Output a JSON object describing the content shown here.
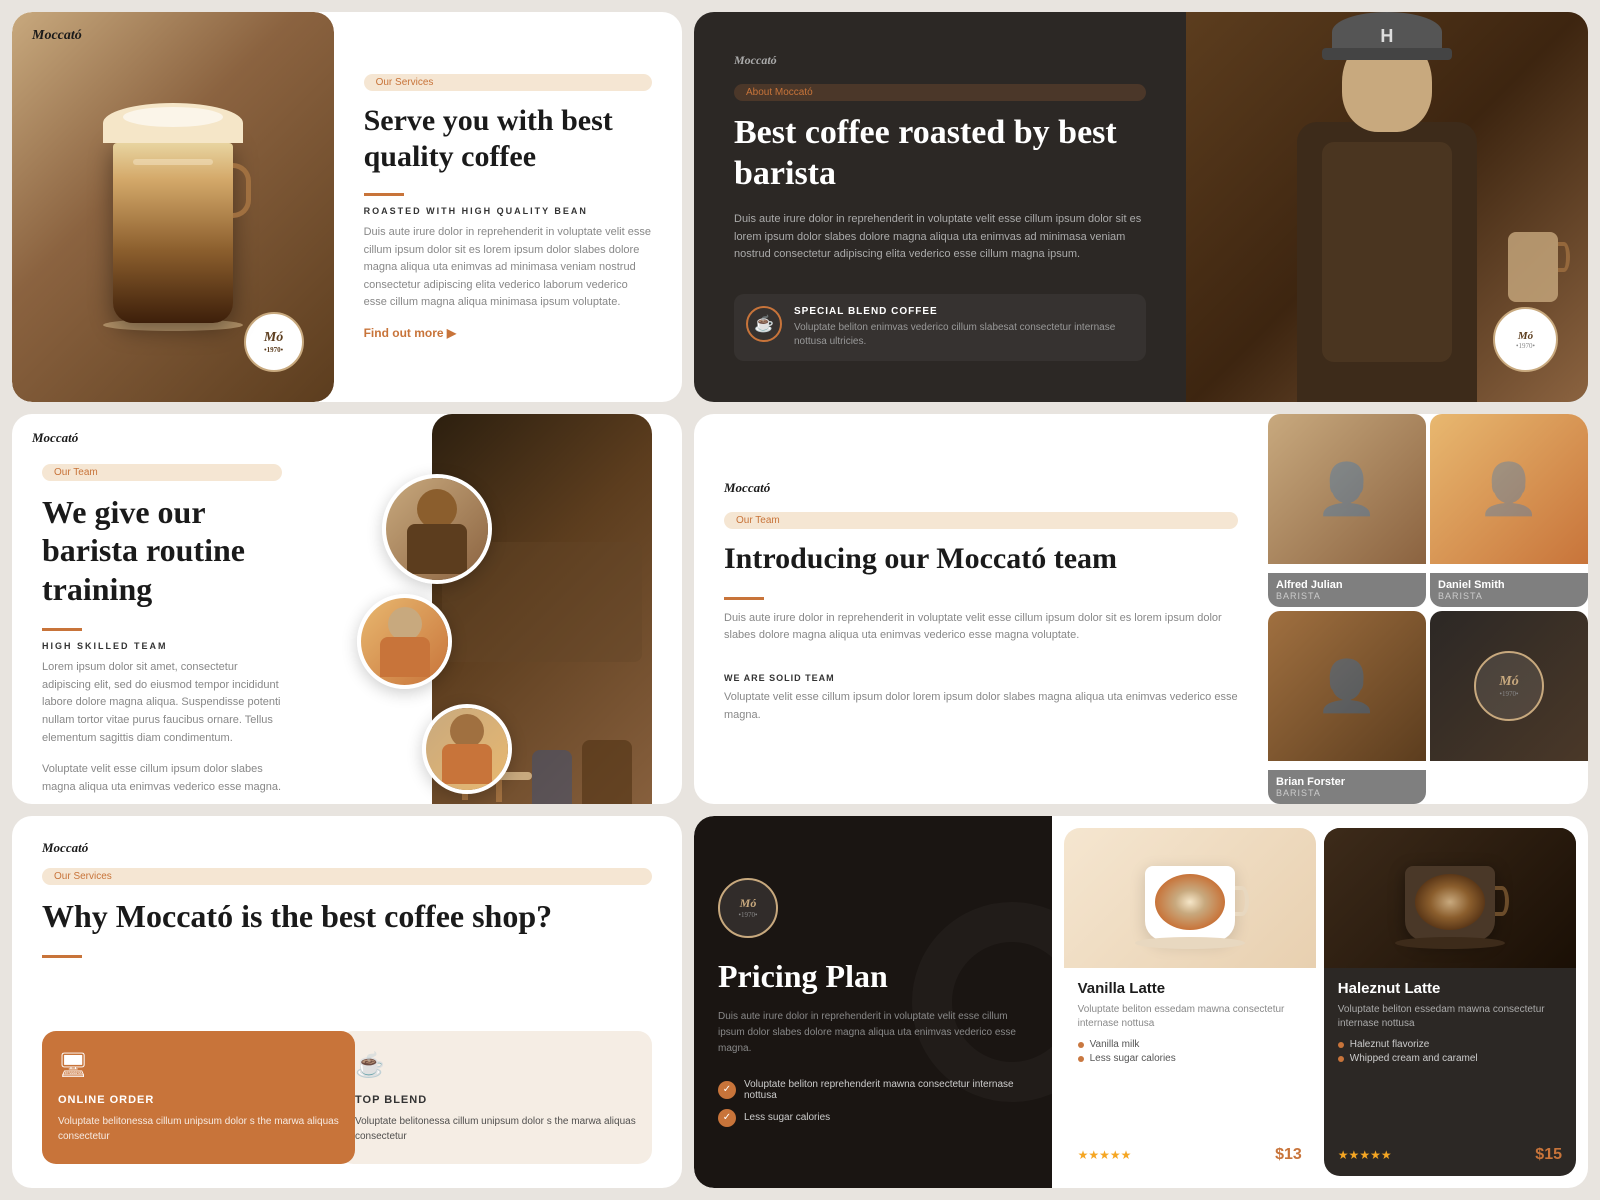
{
  "brand": {
    "name": "Moccató",
    "logo": "Mó",
    "logo_year": "•1970•"
  },
  "card1": {
    "tag": "Our Services",
    "title": "Serve you with best quality coffee",
    "subtitle": "ROASTED WITH HIGH QUALITY BEAN",
    "body": "Duis aute irure dolor in reprehenderit in voluptate velit esse cillum ipsum dolor sit es lorem ipsum dolor slabes dolore magna aliqua uta enimvas ad minimasa veniam nostrud consectetur adipiscing elita vederico laborum vederico esse cillum magna aliqua minimasa ipsum voluptate.",
    "cta": "Find out more ▶"
  },
  "card2": {
    "tag": "About Moccató",
    "title": "Best coffee roasted by best barista",
    "body": "Duis aute irure dolor in reprehenderit in voluptate velit esse cillum ipsum dolor sit es lorem ipsum dolor slabes dolore magna aliqua uta enimvas ad minimasa veniam nostrud consectetur adipiscing elita vederico esse cillum magna ipsum.",
    "blend_title": "SPECIAL BLEND COFFEE",
    "blend_body": "Voluptate beliton enimvas vederico cillum slabesat consectetur internase nottusa ultricies."
  },
  "card3": {
    "tag": "Our Team",
    "title": "We give our barista routine training",
    "subtitle": "HIGH SKILLED TEAM",
    "body1": "Lorem ipsum dolor sit amet, consectetur adipiscing elit, sed do eiusmod tempor incididunt labore dolore magna aliqua. Suspendisse potenti nullam tortor vitae purus faucibus ornare. Tellus elementum sagittis diam condimentum.",
    "body2": "Voluptate velit esse cillum ipsum dolor slabes magna aliqua uta enimvas vederico esse magna."
  },
  "card4": {
    "tag": "Our Team",
    "title": "Introducing our Moccató team",
    "body": "Duis aute irure dolor in reprehenderit in voluptate velit esse cillum ipsum dolor sit es lorem ipsum dolor slabes dolore magna aliqua uta enimvas vederico esse magna voluptate.",
    "team_label": "WE ARE SOLID TEAM",
    "team_body": "Voluptate velit esse cillum ipsum dolor lorem ipsum dolor slabes magna aliqua uta enimvas vederico esse magna.",
    "members": [
      {
        "name": "Alfred Julian",
        "role": "BARISTA"
      },
      {
        "name": "Daniel Smith",
        "role": "BARISTA"
      },
      {
        "name": "Brian Forster",
        "role": "BARISTA"
      },
      {
        "name": "logo",
        "role": ""
      }
    ]
  },
  "card5": {
    "tag": "Our Services",
    "title": "Why Moccató is the best coffee shop?",
    "service1": {
      "icon": "🖥",
      "title": "ONLINE ORDER",
      "body": "Voluptate belitonessa cillum unipsum dolor s the marwa aliquas consectetur"
    },
    "service2": {
      "icon": "☕",
      "title": "TOP BLEND",
      "body": "Voluptate belitonessa cillum unipsum dolor s the marwa aliquas consectetur"
    }
  },
  "card6": {
    "title": "Pricing Plan",
    "body": "Duis aute irure dolor in reprehenderit in voluptate velit esse cillum ipsum dolor slabes dolore magna aliqua uta enimvas vederico esse magna.",
    "check1": "Voluptate beliton reprehenderit mawna consectetur internase nottusa",
    "check2": "Less sugar calories",
    "products": [
      {
        "name": "Vanilla Latte",
        "desc": "Voluptate beliton essedam mawna consectetur internase nottusa",
        "ingredients": [
          "Vanilla milk",
          "Less sugar calories"
        ],
        "stars": "★★★★★",
        "price": "$13",
        "dark": false
      },
      {
        "name": "Haleznut Latte",
        "desc": "Voluptate beliton essedam mawna consectetur internase nottusa",
        "ingredients": [
          "Haleznut flavorize",
          "Whipped cream and caramel"
        ],
        "stars": "★★★★★",
        "price": "$15",
        "dark": true
      }
    ]
  }
}
